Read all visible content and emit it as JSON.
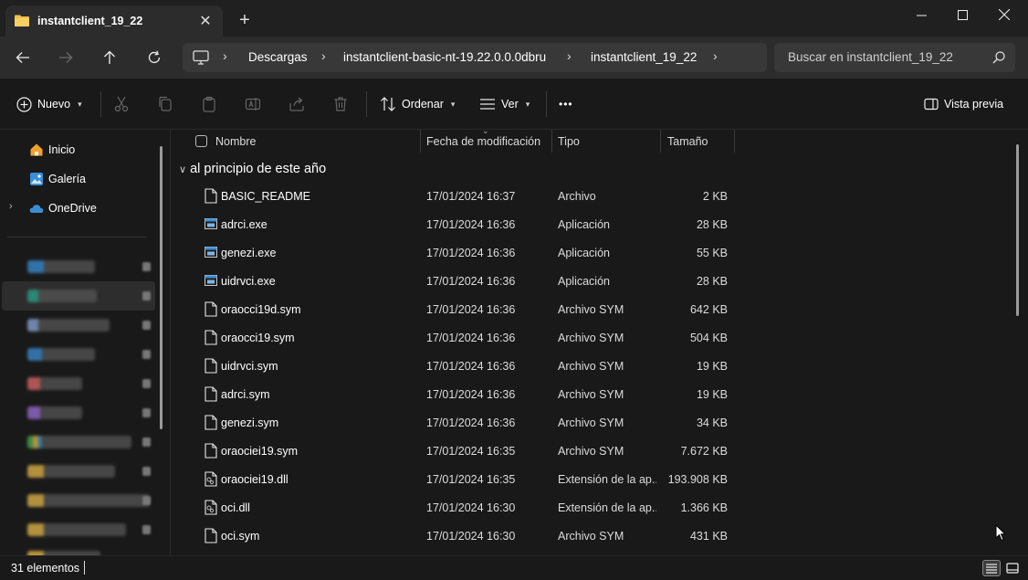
{
  "window": {
    "tab_title": "instantclient_19_22",
    "tab_icon": "folder-icon",
    "new_tab_label": "+",
    "controls": [
      "minimize",
      "maximize",
      "close"
    ]
  },
  "address": {
    "breadcrumbs": [
      "Descargas",
      "instantclient-basic-nt-19.22.0.0.0dbru",
      "instantclient_19_22"
    ],
    "search_placeholder": "Buscar en instantclient_19_22"
  },
  "commands": {
    "new_label": "Nuevo",
    "sort_label": "Ordenar",
    "view_label": "Ver",
    "preview_label": "Vista previa",
    "more_label": "•••"
  },
  "sidebar": {
    "items": [
      {
        "label": "Inicio",
        "icon": "home-icon"
      },
      {
        "label": "Galería",
        "icon": "gallery-icon"
      },
      {
        "label": "OneDrive",
        "icon": "cloud-icon"
      }
    ],
    "blurred_colors": [
      "#3b8fd6",
      "#2aa58a",
      "#8aa9d8",
      "#3b8fd6",
      "#e06a6a",
      "#9b6fd6",
      "#4caf50",
      "#e6b84a",
      "#e6b84a",
      "#e6b84a",
      "#e6b84a"
    ]
  },
  "columns": {
    "name": "Nombre",
    "date": "Fecha de modificación",
    "type": "Tipo",
    "size": "Tamaño"
  },
  "group_label": "al principio de este año",
  "files": [
    {
      "name": "BASIC_README",
      "date": "17/01/2024 16:37",
      "type": "Archivo",
      "size": "2 KB",
      "icon": "file-icon"
    },
    {
      "name": "adrci.exe",
      "date": "17/01/2024 16:36",
      "type": "Aplicación",
      "size": "28 KB",
      "icon": "app-icon"
    },
    {
      "name": "genezi.exe",
      "date": "17/01/2024 16:36",
      "type": "Aplicación",
      "size": "55 KB",
      "icon": "app-icon"
    },
    {
      "name": "uidrvci.exe",
      "date": "17/01/2024 16:36",
      "type": "Aplicación",
      "size": "28 KB",
      "icon": "app-icon"
    },
    {
      "name": "oraocci19d.sym",
      "date": "17/01/2024 16:36",
      "type": "Archivo SYM",
      "size": "642 KB",
      "icon": "file-icon"
    },
    {
      "name": "oraocci19.sym",
      "date": "17/01/2024 16:36",
      "type": "Archivo SYM",
      "size": "504 KB",
      "icon": "file-icon"
    },
    {
      "name": "uidrvci.sym",
      "date": "17/01/2024 16:36",
      "type": "Archivo SYM",
      "size": "19 KB",
      "icon": "file-icon"
    },
    {
      "name": "adrci.sym",
      "date": "17/01/2024 16:36",
      "type": "Archivo SYM",
      "size": "19 KB",
      "icon": "file-icon"
    },
    {
      "name": "genezi.sym",
      "date": "17/01/2024 16:36",
      "type": "Archivo SYM",
      "size": "34 KB",
      "icon": "file-icon"
    },
    {
      "name": "oraociei19.sym",
      "date": "17/01/2024 16:35",
      "type": "Archivo SYM",
      "size": "7.672 KB",
      "icon": "file-icon"
    },
    {
      "name": "oraociei19.dll",
      "date": "17/01/2024 16:35",
      "type": "Extensión de la ap...",
      "size": "193.908 KB",
      "icon": "dll-icon"
    },
    {
      "name": "oci.dll",
      "date": "17/01/2024 16:30",
      "type": "Extensión de la ap...",
      "size": "1.366 KB",
      "icon": "dll-icon"
    },
    {
      "name": "oci.sym",
      "date": "17/01/2024 16:30",
      "type": "Archivo SYM",
      "size": "431 KB",
      "icon": "file-icon"
    }
  ],
  "status": {
    "count_label": "31 elementos"
  },
  "colors": {
    "window_bg": "#191919",
    "toolbar_bg": "#2c2c2c",
    "folder": "#f0c04a",
    "accent": "#3b8fd6"
  }
}
